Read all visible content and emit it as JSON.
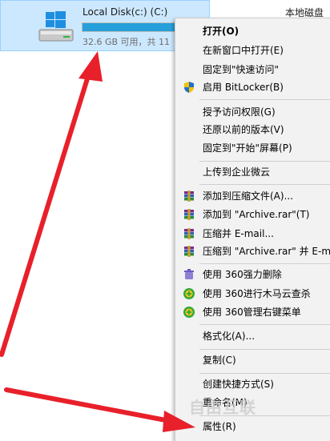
{
  "drive": {
    "name": "Local Disk(c:) (C:)",
    "free_text": "32.6 GB 可用，共 11",
    "used_fraction": 0.87,
    "icon": "windows-drive-icon"
  },
  "top_right_label": "本地磁盘",
  "menu": {
    "items": [
      {
        "label": "打开(O)",
        "bold": true
      },
      {
        "label": "在新窗口中打开(E)"
      },
      {
        "label": "固定到\"快速访问\""
      },
      {
        "label": "启用 BitLocker(B)",
        "icon": "shield-icon"
      },
      {
        "label": "授予访问权限(G)"
      },
      {
        "label": "还原以前的版本(V)"
      },
      {
        "label": "固定到\"开始\"屏幕(P)"
      },
      {
        "label": "上传到企业微云"
      },
      {
        "label": "添加到压缩文件(A)...",
        "icon": "winrar-icon"
      },
      {
        "label": "添加到 \"Archive.rar\"(T)",
        "icon": "winrar-icon"
      },
      {
        "label": "压缩并 E-mail...",
        "icon": "winrar-icon"
      },
      {
        "label": "压缩到 \"Archive.rar\" 并 E-ma",
        "icon": "winrar-icon"
      },
      {
        "label": "使用 360强力删除",
        "icon": "360-delete-icon"
      },
      {
        "label": "使用 360进行木马云查杀",
        "icon": "360-scan-icon"
      },
      {
        "label": "使用 360管理右键菜单",
        "icon": "360-scan-icon"
      },
      {
        "label": "格式化(A)..."
      },
      {
        "label": "复制(C)"
      },
      {
        "label": "创建快捷方式(S)"
      },
      {
        "label": "重命名(M)"
      },
      {
        "label": "属性(R)"
      }
    ]
  },
  "watermark": "自由互联",
  "colors": {
    "accent_arrow": "#e8202a",
    "selection": "#cce8ff",
    "progress": "#26a0da"
  }
}
